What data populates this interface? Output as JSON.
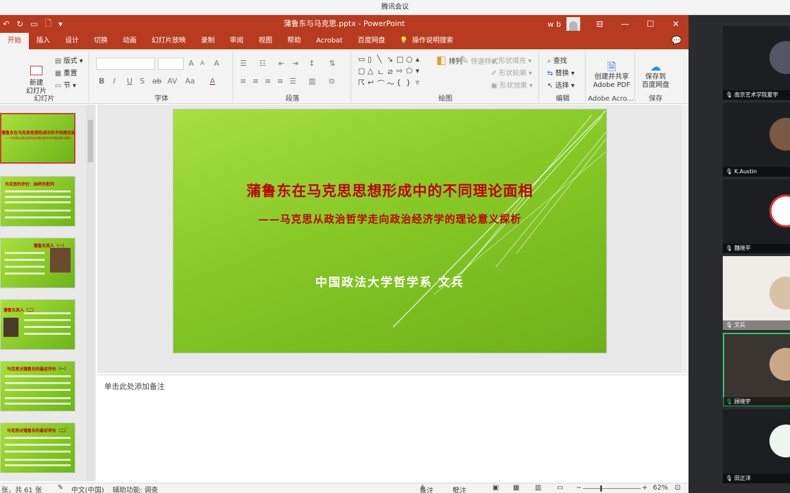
{
  "meeting_app": {
    "title": "腾讯会议"
  },
  "window": {
    "doc_title": "蒲鲁东与马克思.pptx  -  PowerPoint",
    "user": "w b",
    "minimize": "—",
    "restore": "☐",
    "close": "✕",
    "layout_btn": "⊟",
    "comment_icon": "💬"
  },
  "tabs": [
    "开始",
    "插入",
    "设计",
    "切换",
    "动画",
    "幻灯片放映",
    "录制",
    "审阅",
    "视图",
    "帮助",
    "Acrobat",
    "百度网盘"
  ],
  "search_label": "操作说明搜索",
  "ribbon": {
    "slides": {
      "new_slide": "新建\n幻灯片",
      "layout": "版式",
      "reset": "重置",
      "section": "节",
      "label": "幻灯片"
    },
    "font": {
      "label": "字体",
      "bold": "B",
      "italic": "I",
      "underline": "U",
      "strike": "S",
      "shadow": "ab",
      "spacing": "AV",
      "case": "Aa",
      "grow": "A",
      "shrink": "A",
      "clear": "A",
      "color": "A"
    },
    "paragraph": {
      "label": "段落"
    },
    "drawing": {
      "label": "绘图",
      "arrange": "排列",
      "quick_styles": "快速样式",
      "fill": "形状填充",
      "outline": "形状轮廓",
      "effects": "形状效果"
    },
    "editing": {
      "label": "编辑",
      "find": "查找",
      "replace": "替换",
      "select": "选择"
    },
    "acrobat": {
      "label": "Adobe Acro...",
      "create": "创建并共享\nAdobe PDF"
    },
    "save": {
      "label": "保存",
      "save_to": "保存到\n百度网盘"
    }
  },
  "slide": {
    "title": "蒲鲁东在马克思思想形成中的不同理论面相",
    "subtitle": "——马克思从政治哲学走向政治经济学的理论意义探析",
    "author": "中国政法大学哲学系 文兵"
  },
  "thumbnails": [
    {
      "title": "蒲鲁东在马克思思想形成中的不同理论面相",
      "sub": "——马克思从政治哲学走向政治经济学的理论意义探析",
      "selected": true
    },
    {
      "title": "马克思的评价：始终的批判",
      "selected": false
    },
    {
      "title": "蒲鲁东其人（一）",
      "selected": false
    },
    {
      "title": "蒲鲁东其人（二）",
      "selected": false
    },
    {
      "title": "马克思对蒲鲁东的最初评价（一）",
      "selected": false
    },
    {
      "title": "马克思对蒲鲁东的最初评价（二）",
      "selected": false
    }
  ],
  "notes_placeholder": "单击此处添加备注",
  "status": {
    "slide_count": "张，共 61 张",
    "language": "中文(中国)",
    "accessibility": "辅助功能: 调查",
    "notes": "备注",
    "comments": "批注",
    "zoom": "62%"
  },
  "participants": [
    {
      "name": "南京艺术学院夏宇",
      "speaking": false
    },
    {
      "name": "K.Austin",
      "speaking": false
    },
    {
      "name": "魏晓平",
      "speaking": false
    },
    {
      "name": "文兵",
      "speaking": false
    },
    {
      "name": "顾晓宇",
      "speaking": true
    },
    {
      "name": "田正洋",
      "speaking": false
    }
  ],
  "colors": {
    "ppt_brand": "#b83b1f",
    "slide_green": "#86c927",
    "title_red": "#c00000",
    "speaking": "#2ecc71"
  }
}
